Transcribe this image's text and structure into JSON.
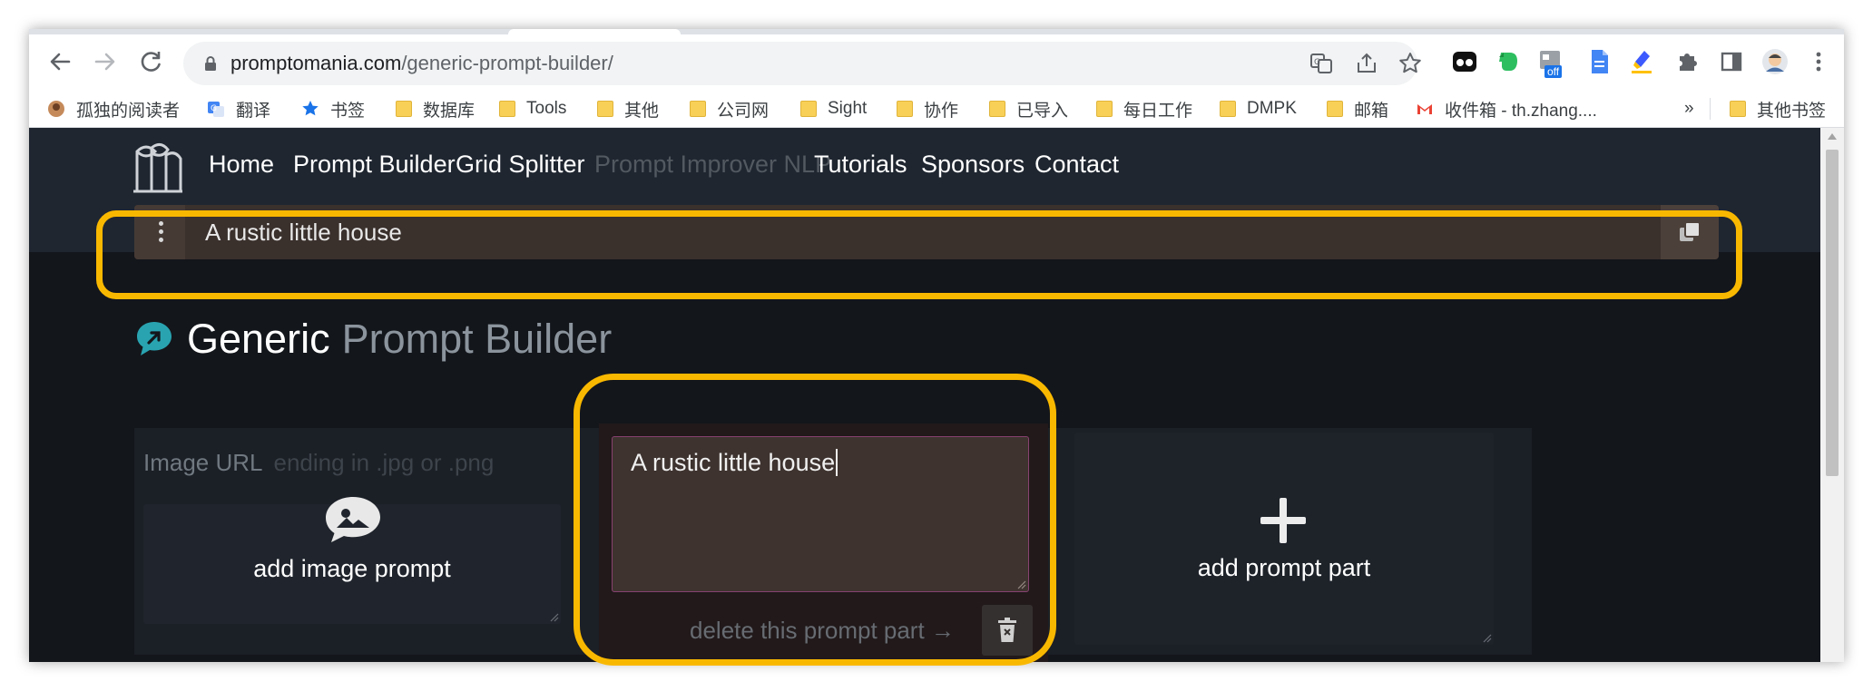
{
  "browser": {
    "url_host": "promptomania.com",
    "url_path": "/generic-prompt-builder/",
    "overflow_chevron": "»",
    "extension_badge": "off",
    "bookmarks": [
      {
        "label": "孤独的阅读者",
        "icon": "avatar-icon"
      },
      {
        "label": "翻译",
        "icon": "google-translate-icon"
      },
      {
        "label": "书签",
        "icon": "star-icon"
      },
      {
        "label": "数据库",
        "icon": "folder-icon"
      },
      {
        "label": "Tools",
        "icon": "folder-icon"
      },
      {
        "label": "其他",
        "icon": "folder-icon"
      },
      {
        "label": "公司网",
        "icon": "folder-icon"
      },
      {
        "label": "Sight",
        "icon": "folder-icon"
      },
      {
        "label": "协作",
        "icon": "folder-icon"
      },
      {
        "label": "已导入",
        "icon": "folder-icon"
      },
      {
        "label": "每日工作",
        "icon": "folder-icon"
      },
      {
        "label": "DMPK",
        "icon": "folder-icon"
      },
      {
        "label": "邮箱",
        "icon": "folder-icon"
      },
      {
        "label": "收件箱 - th.zhang....",
        "icon": "gmail-icon"
      }
    ],
    "other_bookmarks": "其他书签"
  },
  "site": {
    "nav": [
      {
        "label": "Home",
        "disabled": false
      },
      {
        "label": "Prompt Builder",
        "disabled": false
      },
      {
        "label": "Grid Splitter",
        "disabled": false
      },
      {
        "label": "Prompt Improver NLP",
        "disabled": true
      },
      {
        "label": "Tutorials",
        "disabled": false
      },
      {
        "label": "Sponsors",
        "disabled": false
      },
      {
        "label": "Contact",
        "disabled": false
      }
    ],
    "prompt_output": "A rustic little house"
  },
  "builder": {
    "title_strong": "Generic",
    "title_light": "Prompt Builder",
    "image_url_label": "Image URL",
    "image_url_placeholder": "ending in .jpg or .png",
    "add_image_label": "add image prompt",
    "prompt_part_value": "A rustic little house",
    "delete_label": "delete this prompt part →",
    "add_part_label": "add prompt part"
  },
  "colors": {
    "highlight": "#f9b800",
    "page_bg": "#13161b",
    "header_bg": "#1f2630",
    "prompt_bar_bg": "#3a302c",
    "textarea_border": "#874170"
  }
}
